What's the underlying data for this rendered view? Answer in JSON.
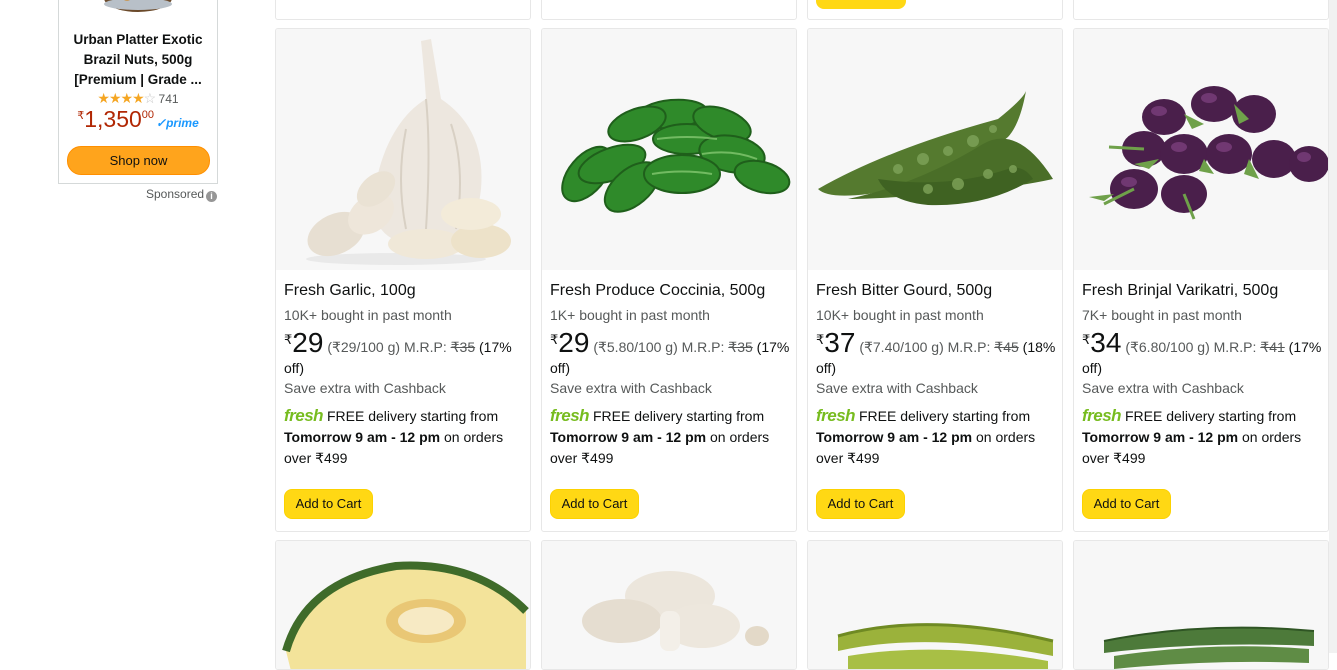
{
  "ad": {
    "title": "Urban Platter Exotic Brazil Nuts, 500g [Premium | Grade ...",
    "stars": "4",
    "rating_count": "741",
    "currency": "₹",
    "price_whole": "1,350",
    "price_fraction": "00",
    "prime": "✓prime",
    "shop_button": "Shop now",
    "sponsored": "Sponsored",
    "info": "i"
  },
  "products": [
    {
      "title": "Fresh Garlic, 100g",
      "bought": "10K+ bought in past month",
      "currency": "₹",
      "price": "29",
      "unit_price": "(₹29/100 g)",
      "mrp_label": "M.R.P:",
      "mrp": "₹35",
      "discount": "(17% off)",
      "cashback": "Save extra with Cashback",
      "fresh_logo": "fresh",
      "delivery_text": "FREE delivery starting from",
      "delivery_time": "Tomorrow 9 am - 12 pm",
      "delivery_cond": "on orders over ₹499",
      "cart_label": "Add to Cart",
      "image": "garlic"
    },
    {
      "title": "Fresh Produce Coccinia, 500g",
      "bought": "1K+ bought in past month",
      "currency": "₹",
      "price": "29",
      "unit_price": "(₹5.80/100 g)",
      "mrp_label": "M.R.P:",
      "mrp": "₹35",
      "discount": "(17% off)",
      "cashback": "Save extra with Cashback",
      "fresh_logo": "fresh",
      "delivery_text": "FREE delivery starting from",
      "delivery_time": "Tomorrow 9 am - 12 pm",
      "delivery_cond": "on orders over ₹499",
      "cart_label": "Add to Cart",
      "image": "coccinia"
    },
    {
      "title": "Fresh Bitter Gourd, 500g",
      "bought": "10K+ bought in past month",
      "currency": "₹",
      "price": "37",
      "unit_price": "(₹7.40/100 g)",
      "mrp_label": "M.R.P:",
      "mrp": "₹45",
      "discount": "(18% off)",
      "cashback": "Save extra with Cashback",
      "fresh_logo": "fresh",
      "delivery_text": "FREE delivery starting from",
      "delivery_time": "Tomorrow 9 am - 12 pm",
      "delivery_cond": "on orders over ₹499",
      "cart_label": "Add to Cart",
      "image": "bitter-gourd"
    },
    {
      "title": "Fresh Brinjal Varikatri, 500g",
      "bought": "7K+ bought in past month",
      "currency": "₹",
      "price": "34",
      "unit_price": "(₹6.80/100 g)",
      "mrp_label": "M.R.P:",
      "mrp": "₹41",
      "discount": "(17% off)",
      "cashback": "Save extra with Cashback",
      "fresh_logo": "fresh",
      "delivery_text": "FREE delivery starting from",
      "delivery_time": "Tomorrow 9 am - 12 pm",
      "delivery_cond": "on orders over ₹499",
      "cart_label": "Add to Cart",
      "image": "brinjal"
    }
  ],
  "next_row_images": [
    "pumpkin",
    "mushroom",
    "banana",
    "ridge-gourd"
  ],
  "colors": {
    "cart_button": "#ffd814",
    "shop_button": "#ffa41c",
    "ad_price": "#b12704",
    "fresh_green": "#77bc1f",
    "prime_blue": "#1a98ff"
  }
}
